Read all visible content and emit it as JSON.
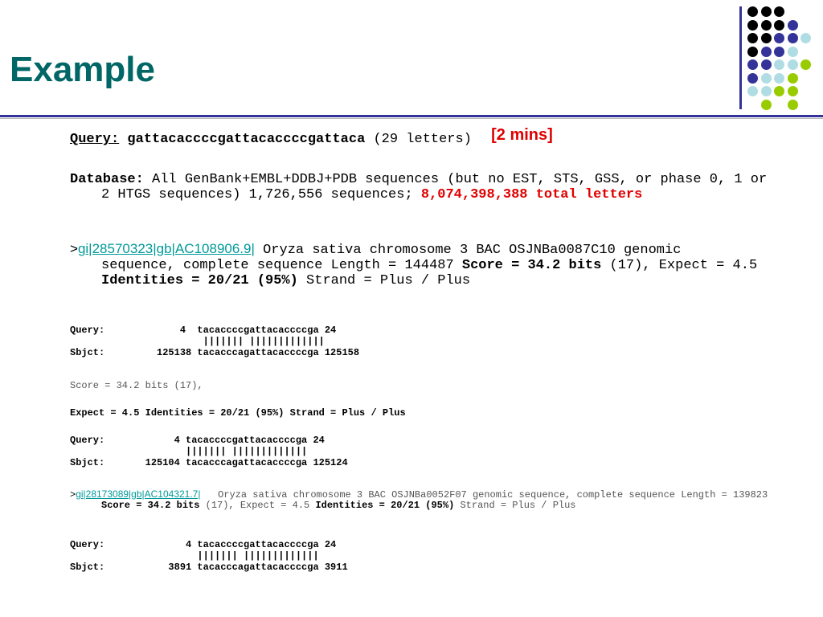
{
  "title": "Example",
  "query": {
    "label": "Query:",
    "seq": "gattacaccccgattacaccccgattaca",
    "len": "(29 letters)",
    "note": "[2 mins]"
  },
  "database": {
    "label": "Database:",
    "text": "All GenBank+EMBL+DDBJ+PDB sequences (but no EST, STS, GSS, or phase 0, 1 or 2 HTGS sequences) 1,726,556 sequences;",
    "total": "8,074,398,388 total letters"
  },
  "hit1": {
    "gt": ">",
    "link": "gi|28570323|gb|AC108906.9|",
    "desc": "Oryza sativa chromosome 3 BAC OSJNBa0087C10 genomic sequence, complete sequence Length = 144487",
    "score": "Score = 34.2 bits",
    "s2": "(17), Expect = 4.5",
    "ident": "Identities = 20/21 (95%)",
    "strand": "Strand = Plus / Plus"
  },
  "aln1": {
    "q": "Query:             4  tacaccccgattacaccccga 24",
    "m": "                       ||||||| |||||||||||||",
    "s": "Sbjct:         125138 tacacccagattacaccccga 125158"
  },
  "score_line": "Score = 34.2 bits (17),",
  "expect_line": "Expect = 4.5 Identities = 20/21 (95%) Strand = Plus / Plus",
  "aln2": {
    "q": "Query:            4 tacaccccgattacaccccga 24",
    "m": "                    ||||||| |||||||||||||",
    "s": "Sbjct:       125104 tacacccagattacaccccga 125124"
  },
  "hit2": {
    "gt": ">",
    "link": "gi|28173089|gb|AC104321.7|",
    "desc": "Oryza sativa chromosome 3 BAC OSJNBa0052F07 genomic sequence, complete sequence Length = 139823",
    "score": "Score = 34.2 bits",
    "s2": "(17), Expect = 4.5",
    "ident": "Identities = 20/21 (95%)",
    "strand": "Strand = Plus / Plus"
  },
  "aln3": {
    "q": "Query:              4 tacaccccgattacaccccga 24",
    "m": "                      ||||||| |||||||||||||",
    "s": "Sbjct:           3891 tacacccagattacaccccga 3911"
  },
  "colors": {
    "black": "#000000",
    "blue": "#333399",
    "light": "#b0dde4",
    "green": "#99cc00"
  }
}
